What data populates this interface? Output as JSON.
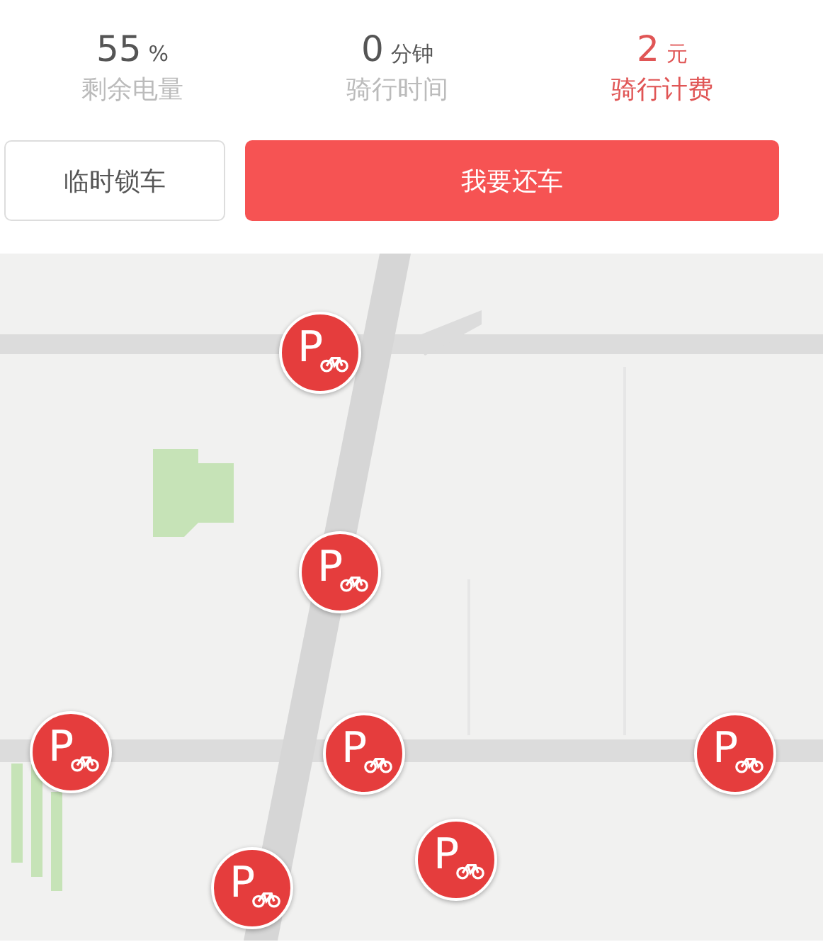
{
  "stats": [
    {
      "value": "55",
      "unit": "%",
      "label": "剩余电量",
      "highlight": false
    },
    {
      "value": "0",
      "unit": "分钟",
      "label": "骑行时间",
      "highlight": false
    },
    {
      "value": "2",
      "unit": "元",
      "label": "骑行计费",
      "highlight": true
    }
  ],
  "buttons": [
    {
      "label": "临时锁车",
      "kind": "secondary"
    },
    {
      "label": "我要还车",
      "kind": "primary"
    }
  ],
  "map": {
    "pins": [
      {
        "label": "P"
      },
      {
        "label": "P"
      },
      {
        "label": "P"
      },
      {
        "label": "P"
      },
      {
        "label": "P"
      },
      {
        "label": "P"
      },
      {
        "label": "P"
      }
    ]
  }
}
